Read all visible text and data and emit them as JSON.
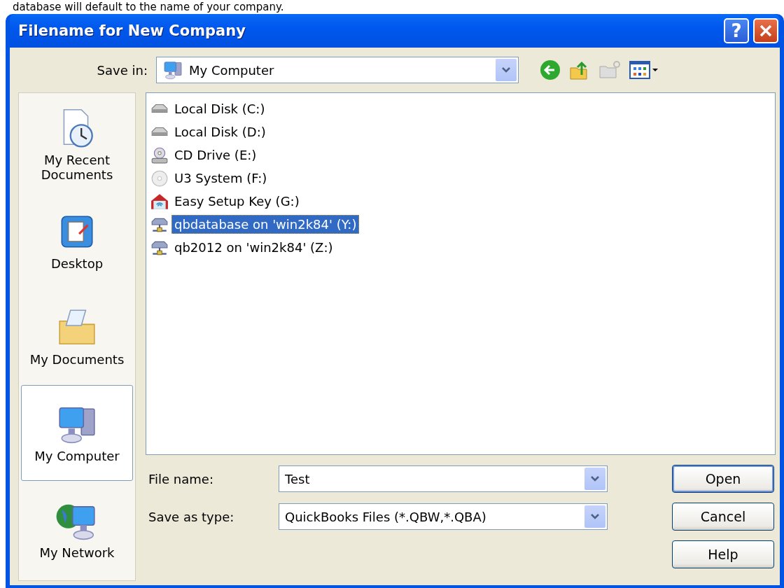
{
  "page_text": "database will default to the name of your company.",
  "window": {
    "title": "Filename for New Company",
    "help": "?"
  },
  "save_in": {
    "label": "Save in:",
    "value": "My Computer"
  },
  "places": [
    {
      "label": "My Recent Documents",
      "kind": "recent",
      "selected": false
    },
    {
      "label": "Desktop",
      "kind": "desktop",
      "selected": false
    },
    {
      "label": "My Documents",
      "kind": "documents",
      "selected": false
    },
    {
      "label": "My Computer",
      "kind": "computer",
      "selected": true
    },
    {
      "label": "My Network",
      "kind": "network",
      "selected": false
    }
  ],
  "files": [
    {
      "name": "Local Disk (C:)",
      "kind": "disk",
      "selected": false
    },
    {
      "name": "Local Disk (D:)",
      "kind": "disk",
      "selected": false
    },
    {
      "name": "CD Drive (E:)",
      "kind": "cd",
      "selected": false
    },
    {
      "name": "U3 System (F:)",
      "kind": "disc",
      "selected": false
    },
    {
      "name": "Easy Setup Key (G:)",
      "kind": "key",
      "selected": false
    },
    {
      "name": "qbdatabase on 'win2k84' (Y:)",
      "kind": "network",
      "selected": true
    },
    {
      "name": "qb2012 on 'win2k84' (Z:)",
      "kind": "network",
      "selected": false
    }
  ],
  "file_name": {
    "label": "File name:",
    "value": "Test"
  },
  "save_as_type": {
    "label": "Save as type:",
    "value": "QuickBooks Files (*.QBW,*.QBA)"
  },
  "buttons": [
    {
      "label": "Open",
      "default": true
    },
    {
      "label": "Cancel",
      "default": false
    },
    {
      "label": "Help",
      "default": false
    }
  ]
}
